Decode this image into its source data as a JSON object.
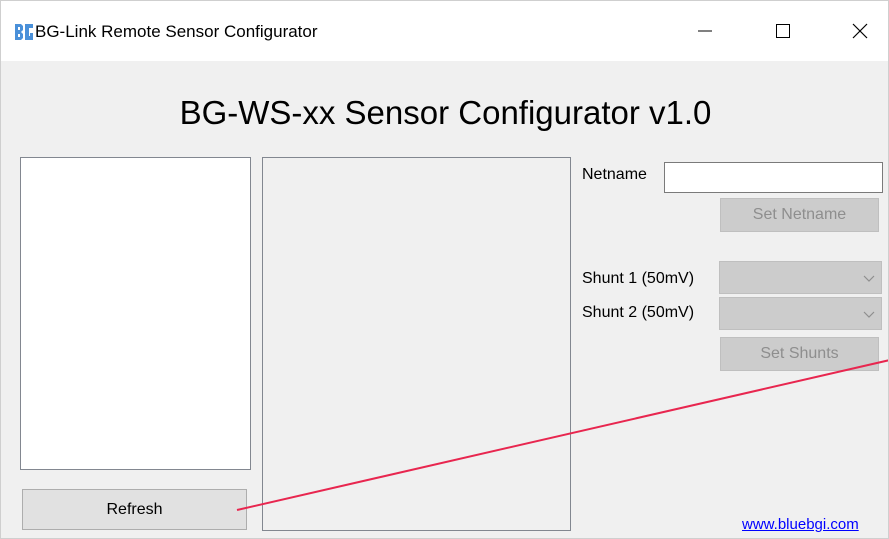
{
  "window": {
    "title": "BG-Link Remote Sensor Configurator",
    "icon": "bg-link-app-icon",
    "controls": {
      "minimize_icon": "minimize-icon",
      "maximize_icon": "maximize-icon",
      "close_icon": "close-icon"
    }
  },
  "main": {
    "heading": "BG-WS-xx Sensor Configurator v1.0",
    "device_list": {
      "items": []
    },
    "details_panel": {
      "items": []
    },
    "refresh_label": "Refresh"
  },
  "netname": {
    "label": "Netname",
    "value": "",
    "placeholder": "",
    "set_label": "Set Netname"
  },
  "shunts": {
    "shunt1_label": "Shunt 1 (50mV)",
    "shunt1_value": "",
    "shunt2_label": "Shunt 2 (50mV)",
    "shunt2_value": "",
    "set_label": "Set Shunts"
  },
  "footer": {
    "link_text": "www.bluebgi.com"
  },
  "colors": {
    "window_bg": "#f0f0f0",
    "titlebar_bg": "#ffffff",
    "disabled_bg": "#cccccc",
    "disabled_text": "#8e8e8e",
    "link": "#0000ff",
    "annotation_line": "#e8264f",
    "icon_blue": "#4a90d9"
  }
}
